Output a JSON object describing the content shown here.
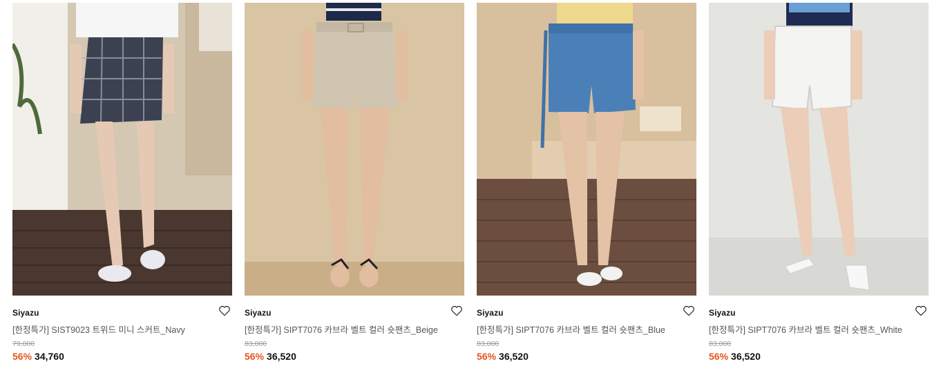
{
  "products": [
    {
      "brand": "Siyazu",
      "title": "[한정특가] SIST9023 트위드 미니 스커트_Navy",
      "original_price": "79,000",
      "discount": "56%",
      "price": "34,760",
      "wishlist_icon": "heart-outline-icon",
      "image_colors": {
        "background": "#cfc2ac",
        "garment": "#3c4152",
        "floor": "#4a3830"
      }
    },
    {
      "brand": "Siyazu",
      "title": "[한정특가] SIPT7076 카브라 벨트 컬러 숏팬츠_Beige",
      "original_price": "83,000",
      "discount": "56%",
      "price": "36,520",
      "wishlist_icon": "heart-outline-icon",
      "image_colors": {
        "background": "#d9c4a3",
        "garment": "#cec4b0",
        "floor": "#cbb18d"
      }
    },
    {
      "brand": "Siyazu",
      "title": "[한정특가] SIPT7076 카브라 벨트 컬러 숏팬츠_Blue",
      "original_price": "83,000",
      "discount": "56%",
      "price": "36,520",
      "wishlist_icon": "heart-outline-icon",
      "image_colors": {
        "background": "#d8bf9d",
        "garment": "#4a7fb8",
        "floor": "#6b4e3f"
      }
    },
    {
      "brand": "Siyazu",
      "title": "[한정특가] SIPT7076 카브라 벨트 컬러 숏팬츠_White",
      "original_price": "83,000",
      "discount": "56%",
      "price": "36,520",
      "wishlist_icon": "heart-outline-icon",
      "image_colors": {
        "background": "#e4e4e0",
        "garment": "#f4f4f2",
        "floor": "#d6d6d2"
      }
    }
  ],
  "colors": {
    "discount": "#e8541e",
    "price": "#111111",
    "original_price": "#999999"
  }
}
